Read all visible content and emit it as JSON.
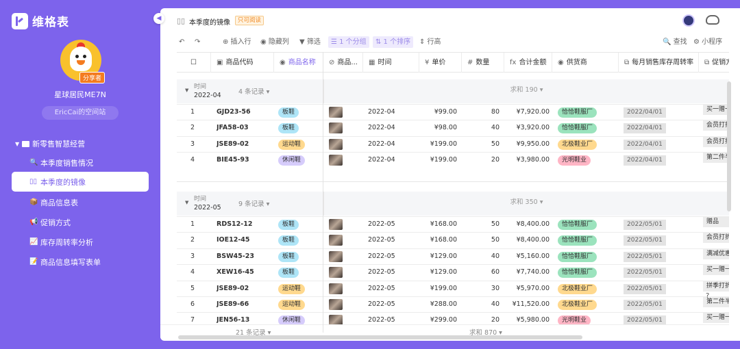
{
  "app": {
    "name": "维格表",
    "collapse_icon": "◀"
  },
  "user": {
    "name": "星球居民ME7N",
    "space": "EricCai的空间站",
    "badge": "分享者"
  },
  "folder": {
    "label": "新零售智慧经营",
    "caret": "▼"
  },
  "nav": [
    {
      "icon": "🔍",
      "label": "本季度销售情况",
      "active": false
    },
    {
      "icon": "▯▯",
      "label": "本季度的镜像",
      "active": true
    },
    {
      "icon": "📦",
      "label": "商品信息表",
      "active": false
    },
    {
      "icon": "📢",
      "label": "促销方式",
      "active": false
    },
    {
      "icon": "📈",
      "label": "库存周转率分析",
      "active": false
    },
    {
      "icon": "📝",
      "label": "商品信息填写表单",
      "active": false
    }
  ],
  "view": {
    "icon": "▯▯",
    "title": "本季度的镜像",
    "readonly_badge": "只可阅读"
  },
  "toolbar": {
    "undo": "↶",
    "redo": "↷",
    "insert_row": "⊕ 插入行",
    "hide_cols": "◉ 隐藏列",
    "filter": "▼ 筛选",
    "group": "☰ 1 个分组",
    "sort": "⇅ 1 个排序",
    "row_height": "⇕ 行高",
    "search": "🔍 查找",
    "miniapp": "⚙ 小程序"
  },
  "columns": [
    {
      "icon": "▣",
      "label": "商品代码"
    },
    {
      "icon": "◉",
      "label": "商品名称"
    },
    {
      "icon": "⊘",
      "label": "商品..."
    },
    {
      "icon": "▦",
      "label": "时间"
    },
    {
      "icon": "¥",
      "label": "单价"
    },
    {
      "icon": "#",
      "label": "数量"
    },
    {
      "icon": "fx",
      "label": "合计金额"
    },
    {
      "icon": "◉",
      "label": "供货商"
    },
    {
      "icon": "⧉",
      "label": "每月销售库存周转率"
    },
    {
      "icon": "⧉",
      "label": "促销方"
    }
  ],
  "tag_colors": {
    "板鞋": "#aee5f7",
    "运动鞋": "#ffd98e",
    "休闲鞋": "#d6ccfb"
  },
  "supplier_colors": {
    "恰恰鞋服厂": "#9be3bd",
    "北极鞋业厂": "#ffd98e",
    "光明鞋业": "#ffb5c5"
  },
  "groups": [
    {
      "field": "时间",
      "value": "2022-04",
      "count": "4 条记录 ▾",
      "sum": "求和 190 ▾",
      "rows": [
        {
          "n": "1",
          "code": "GJD23-56",
          "name": "板鞋",
          "time": "2022-04",
          "price": "¥99.00",
          "qty": "80",
          "total": "¥7,920.00",
          "supplier": "恰恰鞋服厂",
          "turnover": "2022/04/01",
          "promo": "买一赠一"
        },
        {
          "n": "2",
          "code": "JFA58-03",
          "name": "板鞋",
          "time": "2022-04",
          "price": "¥98.00",
          "qty": "40",
          "total": "¥3,920.00",
          "supplier": "恰恰鞋服厂",
          "turnover": "2022/04/01",
          "promo": "会员打折"
        },
        {
          "n": "3",
          "code": "JSE89-02",
          "name": "运动鞋",
          "time": "2022-04",
          "price": "¥199.00",
          "qty": "50",
          "total": "¥9,950.00",
          "supplier": "北极鞋业厂",
          "turnover": "2022/04/01",
          "promo": "会员打折"
        },
        {
          "n": "4",
          "code": "BIE45-93",
          "name": "休闲鞋",
          "time": "2022-04",
          "price": "¥199.00",
          "qty": "20",
          "total": "¥3,980.00",
          "supplier": "光明鞋业",
          "turnover": "2022/04/01",
          "promo": "第二件半价"
        }
      ]
    },
    {
      "field": "时间",
      "value": "2022-05",
      "count": "9 条记录 ▾",
      "sum": "求和 350 ▾",
      "rows": [
        {
          "n": "1",
          "code": "RDS12-12",
          "name": "板鞋",
          "time": "2022-05",
          "price": "¥168.00",
          "qty": "50",
          "total": "¥8,400.00",
          "supplier": "恰恰鞋服厂",
          "turnover": "2022/05/01",
          "promo": "赠品"
        },
        {
          "n": "2",
          "code": "IOE12-45",
          "name": "板鞋",
          "time": "2022-05",
          "price": "¥168.00",
          "qty": "50",
          "total": "¥8,400.00",
          "supplier": "恰恰鞋服厂",
          "turnover": "2022/05/01",
          "promo": "会员打折"
        },
        {
          "n": "3",
          "code": "BSW45-23",
          "name": "板鞋",
          "time": "2022-05",
          "price": "¥129.00",
          "qty": "40",
          "total": "¥5,160.00",
          "supplier": "恰恰鞋服厂",
          "turnover": "2022/05/01",
          "promo": "满减优惠"
        },
        {
          "n": "4",
          "code": "XEW16-45",
          "name": "板鞋",
          "time": "2022-05",
          "price": "¥129.00",
          "qty": "60",
          "total": "¥7,740.00",
          "supplier": "恰恰鞋服厂",
          "turnover": "2022/05/01",
          "promo": "买一赠一"
        },
        {
          "n": "5",
          "code": "JSE89-02",
          "name": "运动鞋",
          "time": "2022-05",
          "price": "¥199.00",
          "qty": "30",
          "total": "¥5,970.00",
          "supplier": "北极鞋业厂",
          "turnover": "2022/05/01",
          "promo": "拼季打折"
        },
        {
          "n": "6",
          "code": "JSE89-66",
          "name": "运动鞋",
          "time": "2022-05",
          "price": "¥288.00",
          "qty": "40",
          "total": "¥11,520.00",
          "supplier": "北极鞋业厂",
          "turnover": "2022/05/01",
          "promo": "第二件半价"
        },
        {
          "n": "7",
          "code": "JEN56-13",
          "name": "休闲鞋",
          "time": "2022-05",
          "price": "¥299.00",
          "qty": "20",
          "total": "¥5,980.00",
          "supplier": "光明鞋业",
          "turnover": "2022/05/01",
          "promo": "买一赠一"
        }
      ]
    }
  ],
  "footer": {
    "count": "21 条记录 ▾",
    "sum": "求和 870 ▾"
  },
  "help": "?"
}
